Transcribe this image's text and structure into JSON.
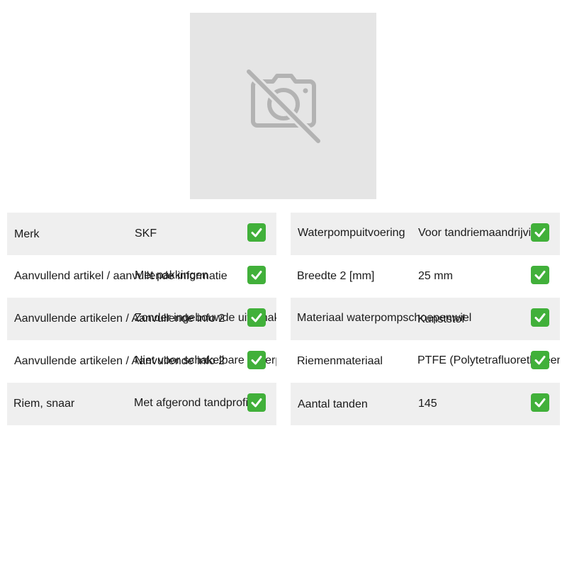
{
  "product_image": {
    "icon": "camera-off-icon",
    "background": "#e5e5e5"
  },
  "specs_left": [
    {
      "label": "Merk",
      "value": "SKF"
    },
    {
      "label": "Aanvullend artikel / aanvullende informatie",
      "value": "Met pakkingen"
    },
    {
      "label": "Aanvullende artikelen / Aanvullende info 2",
      "value": "Zonder ingebouwde uitschakelaar"
    },
    {
      "label": "Aanvullende artikelen / Aanvullende info 2",
      "value": "Niet voor schakelbare waterpomp"
    },
    {
      "label": "Riem, snaar",
      "value": "Met afgerond tandprofiel"
    }
  ],
  "specs_right": [
    {
      "label": "Waterpompuitvoering",
      "value": "Voor tandriemaandrijving"
    },
    {
      "label": "Breedte 2 [mm]",
      "value": "25 mm"
    },
    {
      "label": "Materiaal waterpompschoepenwiel",
      "value": "Kunststof"
    },
    {
      "label": "Riemenmateriaal",
      "value": "PTFE (Polytetrafluorethyleen)"
    },
    {
      "label": "Aantal tanden",
      "value": "145"
    }
  ],
  "check_icon": "check-mark-icon",
  "colors": {
    "row_shade": "#efefef",
    "check_green": "#41b03a"
  }
}
